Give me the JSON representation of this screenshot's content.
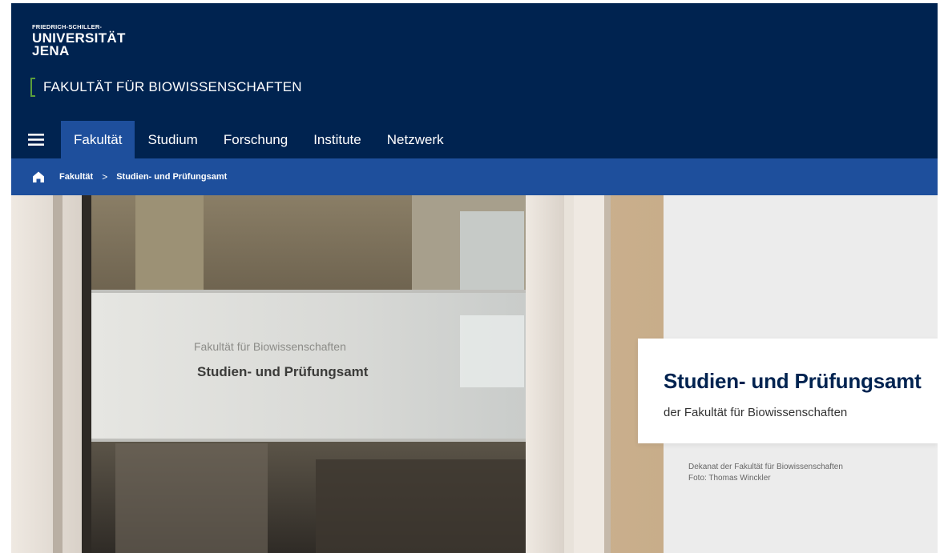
{
  "logo": {
    "line1": "FRIEDRICH-SCHILLER-",
    "line2": "UNIVERSITÄT",
    "line3": "JENA"
  },
  "faculty_title": "FAKULTÄT FÜR BIOWISSENSCHAFTEN",
  "nav": {
    "menu_icon": "hamburger-menu-icon",
    "items": [
      {
        "label": "Fakultät",
        "active": true
      },
      {
        "label": "Studium"
      },
      {
        "label": "Forschung"
      },
      {
        "label": "Institute"
      },
      {
        "label": "Netzwerk"
      }
    ]
  },
  "breadcrumb": {
    "home_icon": "home-icon",
    "items": [
      "Fakultät",
      "Studien- und Prüfungsamt"
    ],
    "separator": ">"
  },
  "hero": {
    "title": "Studien- und Prüfungsamt",
    "subtitle": "der Fakultät für Biowissenschaften",
    "photo_sign_line1": "Fakultät für Biowissenschaften",
    "photo_sign_line2": "Studien- und Prüfungsamt",
    "caption_line1": "Dekanat der Fakultät für Biowissenschaften",
    "caption_line2": "Foto: Thomas Winckler"
  },
  "colors": {
    "header_bg": "#002350",
    "nav_active_bg": "#1e4f9c",
    "breadcrumb_bg": "#1e4f9c",
    "accent_green": "#5b9e3b",
    "hero_title": "#002350"
  }
}
